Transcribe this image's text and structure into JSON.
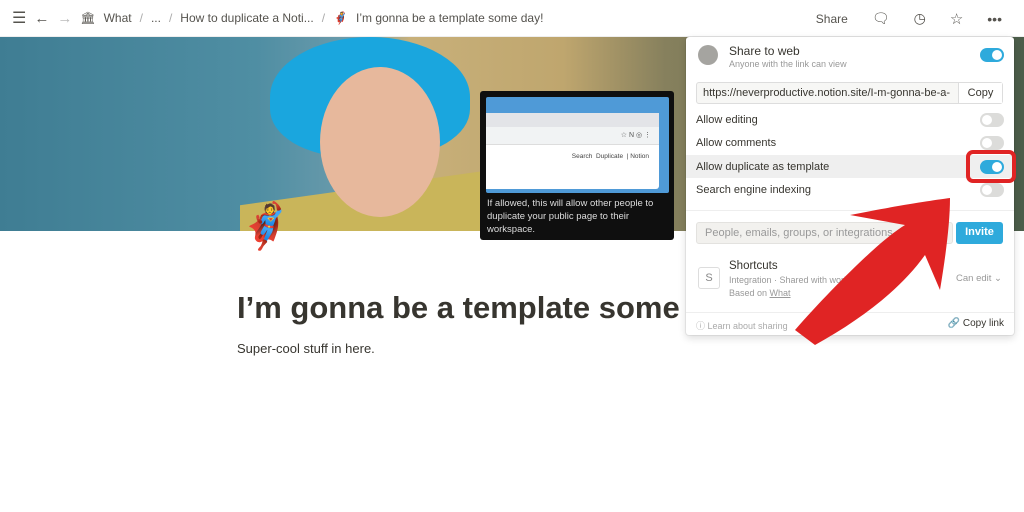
{
  "topbar": {
    "breadcrumb": [
      "What",
      "...",
      "How to duplicate a Noti...",
      "I’m gonna be a template some day!"
    ],
    "share": "Share"
  },
  "page": {
    "title": "I’m gonna be a template some day!",
    "title_visible": "I’m gonna be a template some",
    "subtitle": "Super-cool stuff in here.",
    "icon": "superhero-emoji"
  },
  "tooltip": {
    "text": "If allowed, this will allow other people to duplicate your public page to their workspace.",
    "preview": {
      "search": "Search",
      "duplicate": "Duplicate",
      "notion": "Notion"
    }
  },
  "share": {
    "title": "Share to web",
    "subtitle": "Anyone with the link can view",
    "share_to_web": true,
    "url": "https://neverproductive.notion.site/I-m-gonna-be-a-",
    "copy": "Copy",
    "options": [
      {
        "label": "Allow editing",
        "on": false
      },
      {
        "label": "Allow comments",
        "on": false
      },
      {
        "label": "Allow duplicate as template",
        "on": true
      },
      {
        "label": "Search engine indexing",
        "on": false
      }
    ],
    "invite_placeholder": "People, emails, groups, or integrations",
    "invite": "Invite",
    "member": {
      "initial": "S",
      "name": "Shortcuts",
      "desc": "Integration · Shared with workspace",
      "based_on_prefix": "Based on ",
      "based_on": "What",
      "role": "Can edit"
    },
    "learn": "Learn about sharing",
    "copy_link": "Copy link"
  },
  "colors": {
    "accent": "#2eaadc",
    "annotation": "#e02424"
  }
}
